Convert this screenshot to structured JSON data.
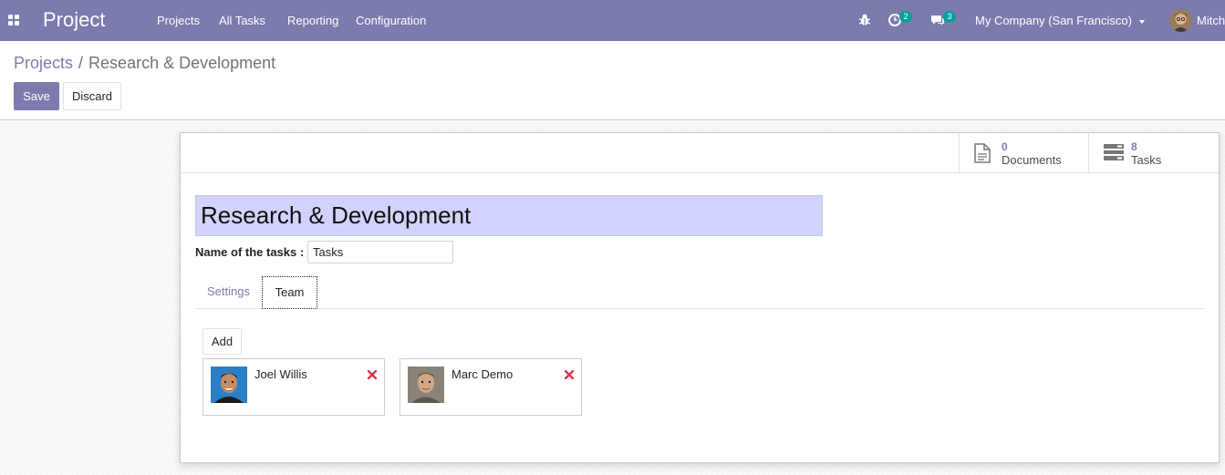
{
  "navbar": {
    "brand": "Project",
    "menu": [
      "Projects",
      "All Tasks",
      "Reporting",
      "Configuration"
    ],
    "activity_count": "2",
    "messages_count": "3",
    "company": "My Company (San Francisco)",
    "user_name": "Mitch"
  },
  "breadcrumb": {
    "parent": "Projects",
    "separator": "/",
    "current": "Research & Development"
  },
  "buttons": {
    "save": "Save",
    "discard": "Discard",
    "add": "Add"
  },
  "stats": {
    "documents_value": "0",
    "documents_label": "Documents",
    "tasks_value": "8",
    "tasks_label": "Tasks"
  },
  "form": {
    "project_name": "Research & Development",
    "tasks_label": "Name of the tasks :",
    "tasks_value": "Tasks"
  },
  "tabs": {
    "settings": "Settings",
    "team": "Team"
  },
  "team": {
    "members": [
      {
        "name": "Joel Willis"
      },
      {
        "name": "Marc Demo"
      }
    ]
  },
  "colors": {
    "brand": "#7c7bad",
    "title_bg": "#d2d2ff",
    "badge": "#00a09d",
    "remove": "#d9334f"
  }
}
